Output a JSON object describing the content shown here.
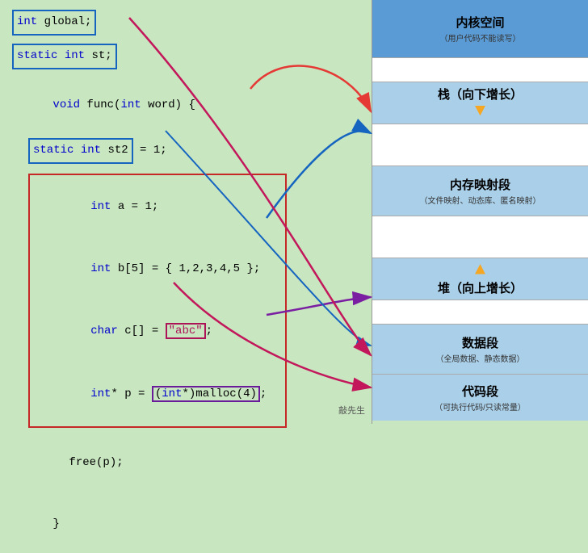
{
  "code_panel": {
    "lines": [
      {
        "id": "line1",
        "text": "int global;"
      },
      {
        "id": "line2",
        "text": ""
      },
      {
        "id": "line3",
        "text": "static int st;"
      },
      {
        "id": "line4",
        "text": ""
      },
      {
        "id": "line5",
        "text": "void func(int word) {"
      },
      {
        "id": "line6",
        "text": ""
      },
      {
        "id": "line7",
        "text": "    static int st2 = 1;"
      },
      {
        "id": "line8",
        "text": ""
      },
      {
        "id": "line9",
        "text": "    int a = 1;"
      },
      {
        "id": "line10",
        "text": ""
      },
      {
        "id": "line11",
        "text": "    int b[5] = { 1,2,3,4,5 };"
      },
      {
        "id": "line12",
        "text": ""
      },
      {
        "id": "line13",
        "text": "    char c[] = \"abc\";"
      },
      {
        "id": "line14",
        "text": ""
      },
      {
        "id": "line15",
        "text": "    int* p = (int*)malloc(4);"
      },
      {
        "id": "line16",
        "text": ""
      },
      {
        "id": "line17",
        "text": "    free(p);"
      },
      {
        "id": "line18",
        "text": "}"
      }
    ]
  },
  "memory_panel": {
    "segments": [
      {
        "id": "kernel",
        "title": "内核空间",
        "subtitle": "（用户代码不能读写）",
        "class": "kernel",
        "arrow": null
      },
      {
        "id": "gap1",
        "title": "",
        "subtitle": "",
        "class": "gap1",
        "arrow": null
      },
      {
        "id": "stack",
        "title": "栈（向下增长）",
        "subtitle": "",
        "class": "stack",
        "arrow": "down"
      },
      {
        "id": "gap2",
        "title": "",
        "subtitle": "",
        "class": "gap2",
        "arrow": null
      },
      {
        "id": "mmap",
        "title": "内存映射段",
        "subtitle": "（文件映射、动态库、匿名映射）",
        "class": "mmap",
        "arrow": null
      },
      {
        "id": "gap3",
        "title": "",
        "subtitle": "",
        "class": "gap3",
        "arrow": null
      },
      {
        "id": "heap",
        "title": "堆（向上增长）",
        "subtitle": "",
        "class": "heap",
        "arrow": "up"
      },
      {
        "id": "gap4",
        "title": "",
        "subtitle": "",
        "class": "gap4",
        "arrow": null
      },
      {
        "id": "data",
        "title": "数据段",
        "subtitle": "（全局数据、静态数据）",
        "class": "data",
        "arrow": null
      },
      {
        "id": "code",
        "title": "代码段",
        "subtitle": "（可执行代码/只读常量）",
        "class": "code",
        "arrow": null
      }
    ]
  },
  "arrows": {
    "red_label": "stack arrow",
    "blue_label": "stack arrow 2",
    "purple_label": "heap arrow",
    "magenta_label": "data arrow",
    "code_arrow_label": "code arrow"
  },
  "watermark": "敲先生"
}
